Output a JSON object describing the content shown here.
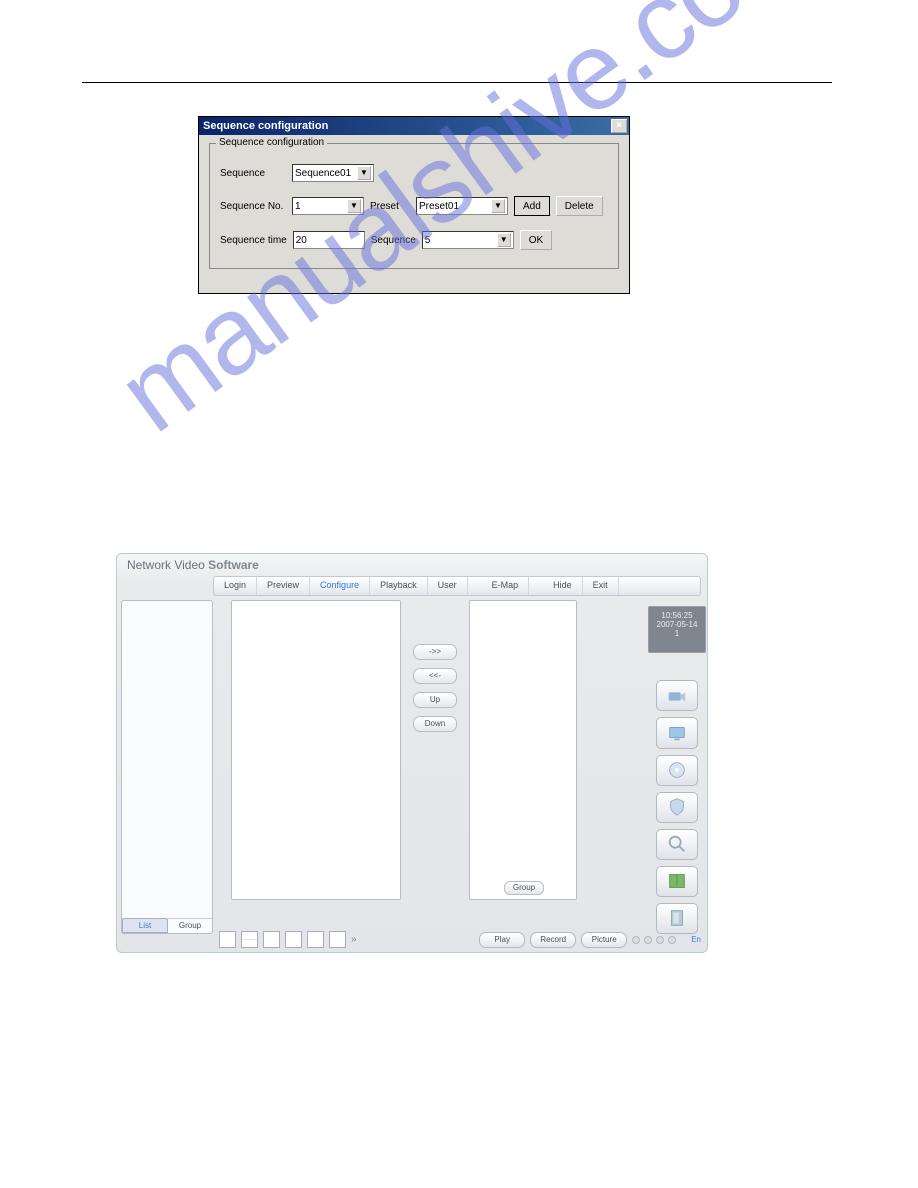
{
  "watermark": "manualshive.com",
  "dialog": {
    "title": "Sequence configuration",
    "legend": "Sequence configuration",
    "labels": {
      "sequence": "Sequence",
      "sequence_no": "Sequence No.",
      "preset": "Preset",
      "sequence_time": "Sequence time",
      "sequence2": "Sequence"
    },
    "values": {
      "sequence": "Sequence01",
      "sequence_no": "1",
      "preset": "Preset01",
      "sequence_time": "20",
      "sequence2": "5"
    },
    "buttons": {
      "add": "Add",
      "delete": "Delete",
      "ok": "OK"
    },
    "close": "×"
  },
  "app": {
    "title_a": "Network Video",
    "title_b": "Software",
    "menu": {
      "login": "Login",
      "preview": "Preview",
      "configure": "Configure",
      "playback": "Playback",
      "user": "User",
      "emap": "E-Map",
      "hide": "Hide",
      "exit": "Exit"
    },
    "clock": {
      "time": "10:56:25",
      "date": "2007-05-14",
      "line3": "1"
    },
    "midbuttons": {
      "right": "->>",
      "left": "<<-",
      "up": "Up",
      "down": "Down"
    },
    "group_btn": "Group",
    "side_tabs": {
      "list": "List",
      "group": "Group"
    },
    "footer": {
      "play": "Play",
      "record": "Record",
      "picture": "Picture",
      "en": "En",
      "more": "»"
    },
    "icons": {
      "camera": "camera-icon",
      "monitor": "monitor-icon",
      "disc": "disc-icon",
      "shield": "shield-icon",
      "search": "search-icon",
      "book": "book-icon",
      "door": "door-icon"
    }
  }
}
